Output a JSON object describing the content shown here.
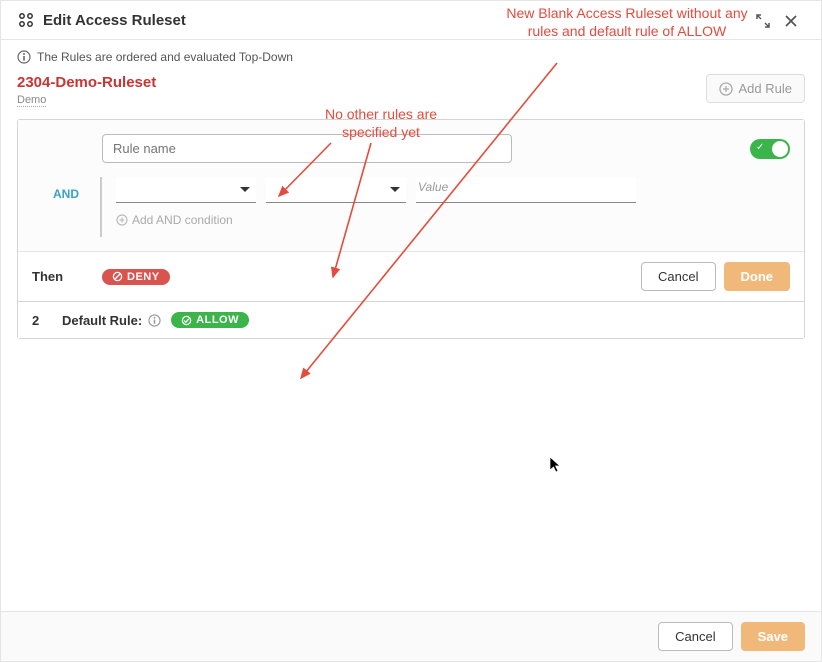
{
  "header": {
    "title": "Edit Access Ruleset"
  },
  "info": {
    "text": "The Rules are ordered and evaluated Top-Down"
  },
  "ruleset": {
    "name": "2304-Demo-Ruleset",
    "description": "Demo"
  },
  "actions": {
    "add_rule_label": "Add Rule",
    "cancel_label": "Cancel",
    "done_label": "Done",
    "save_label": "Save"
  },
  "rule_editor": {
    "name_placeholder": "Rule name",
    "and_label": "AND",
    "value_placeholder": "Value",
    "add_and_label": "Add AND condition",
    "then_label": "Then",
    "deny_label": "DENY"
  },
  "default_rule": {
    "index": "2",
    "label": "Default Rule:",
    "allow_label": "ALLOW"
  },
  "annotations": {
    "top_right": "New Blank Access Ruleset without any rules and default rule of ALLOW",
    "middle": "No other rules are specified yet"
  },
  "colors": {
    "accent_red": "#c33",
    "deny_red": "#d9534f",
    "allow_green": "#3bb44a",
    "primary_orange": "#f0b97a",
    "annotation_red": "#e54b3c"
  }
}
